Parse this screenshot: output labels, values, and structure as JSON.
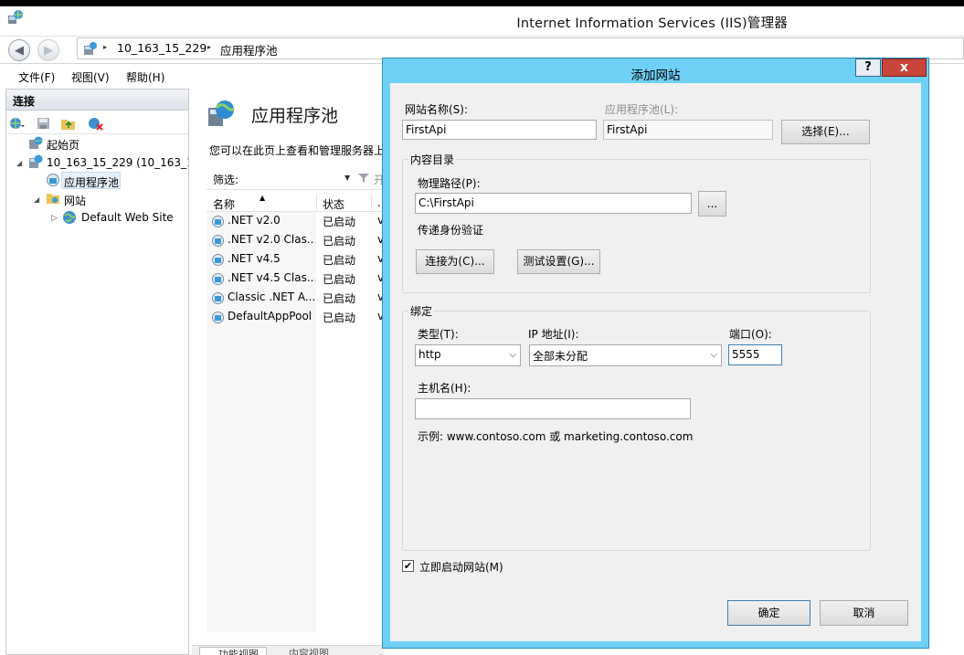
{
  "window": {
    "title": "Internet Information Services (IIS)管理器"
  },
  "address": {
    "crumbs": [
      "10_163_15_229",
      "应用程序池"
    ],
    "sep": "▸"
  },
  "menu": {
    "file": "文件(F)",
    "view": "视图(V)",
    "help": "帮助(H)"
  },
  "connections": {
    "header": "连接",
    "tree": [
      {
        "label": "起始页"
      },
      {
        "label": "10_163_15_229 (10_163_15_"
      },
      {
        "label": "应用程序池"
      },
      {
        "label": "网站"
      },
      {
        "label": "Default Web Site"
      }
    ]
  },
  "main": {
    "title": "应用程序池",
    "description": "您可以在此页上查看和管理服务器上",
    "filter_label": "筛选:",
    "filter_go": "开",
    "columns": [
      "名称",
      "状态",
      "."
    ],
    "rows": [
      {
        "name": ".NET v2.0",
        "status": "已启动",
        "extra": "v"
      },
      {
        "name": ".NET v2.0 Clas...",
        "status": "已启动",
        "extra": "v"
      },
      {
        "name": ".NET v4.5",
        "status": "已启动",
        "extra": "v"
      },
      {
        "name": ".NET v4.5 Clas...",
        "status": "已启动",
        "extra": "v"
      },
      {
        "name": "Classic .NET A...",
        "status": "已启动",
        "extra": "v"
      },
      {
        "name": "DefaultAppPool",
        "status": "已启动",
        "extra": "v"
      }
    ],
    "tabs": [
      "功能视图",
      "内容视图"
    ]
  },
  "dialog": {
    "title": "添加网站",
    "help": "?",
    "close": "x",
    "site_name_label": "网站名称(S):",
    "site_name_value": "FirstApi",
    "app_pool_label": "应用程序池(L):",
    "app_pool_value": "FirstApi",
    "select_button": "选择(E)...",
    "content_group": "内容目录",
    "physical_path_label": "物理路径(P):",
    "physical_path_value": "C:\\FirstApi",
    "browse_button": "...",
    "passthrough_label": "传递身份验证",
    "connect_as_button": "连接为(C)...",
    "test_settings_button": "测试设置(G)...",
    "binding_group": "绑定",
    "type_label": "类型(T):",
    "type_value": "http",
    "ip_label": "IP 地址(I):",
    "ip_value": "全部未分配",
    "port_label": "端口(O):",
    "port_value": "5555",
    "hostname_label": "主机名(H):",
    "hostname_value": "",
    "example_text": "示例: www.contoso.com 或 marketing.contoso.com",
    "start_now_label": "立即启动网站(M)",
    "start_now_checked": true,
    "ok_button": "确定",
    "cancel_button": "取消"
  }
}
